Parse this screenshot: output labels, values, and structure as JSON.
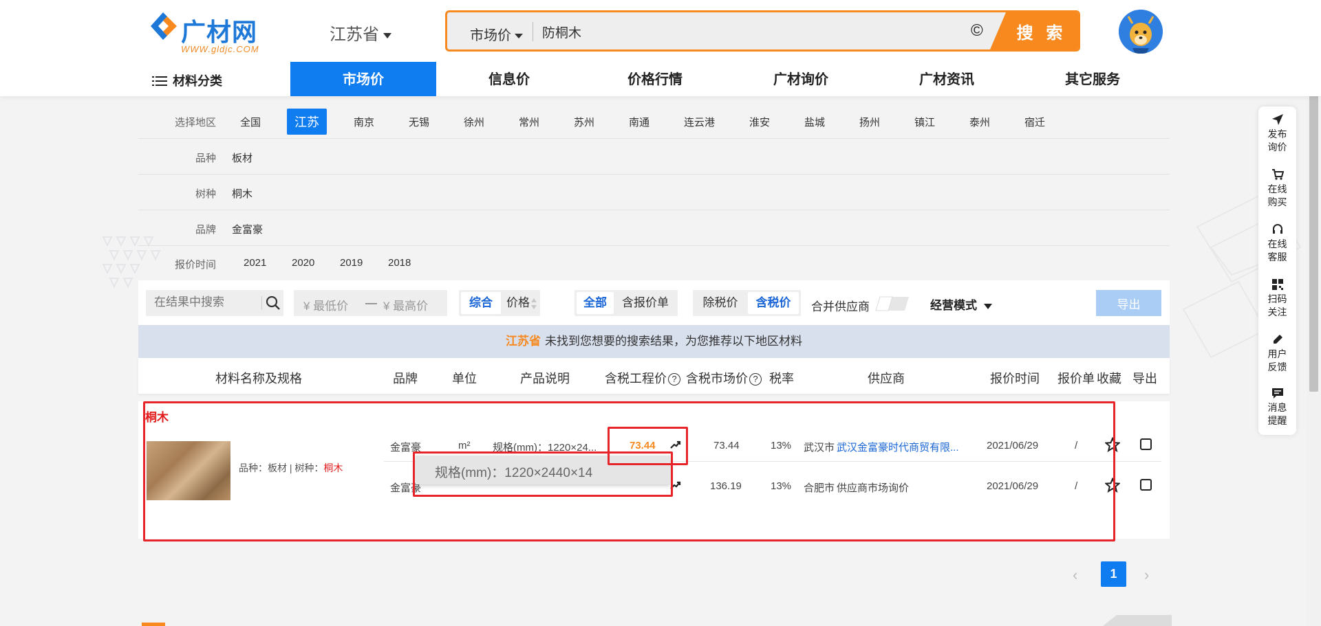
{
  "header": {
    "logo": {
      "text": "广材网",
      "sub": "WWW.gldjc.COM"
    },
    "region": "江苏省",
    "search": {
      "type": "市场价",
      "query": "防桐木",
      "clear_symbol": "©",
      "button": "搜 索"
    }
  },
  "nav": {
    "category": "材料分类",
    "items": [
      "市场价",
      "信息价",
      "价格行情",
      "广材询价",
      "广材资讯",
      "其它服务"
    ],
    "active_index": 0
  },
  "filters": {
    "region": {
      "label": "选择地区",
      "options": [
        "全国",
        "江苏",
        "南京",
        "无锡",
        "徐州",
        "常州",
        "苏州",
        "南通",
        "连云港",
        "淮安",
        "盐城",
        "扬州",
        "镇江",
        "泰州",
        "宿迁"
      ],
      "selected": "江苏"
    },
    "variety": {
      "label": "品种",
      "value": "板材"
    },
    "species": {
      "label": "树种",
      "value": "桐木"
    },
    "brand": {
      "label": "品牌",
      "value": "金富豪"
    },
    "quote_time": {
      "label": "报价时间",
      "options": [
        "2021",
        "2020",
        "2019",
        "2018"
      ]
    }
  },
  "toolbar": {
    "search_placeholder": "在结果中搜索",
    "price_min": "¥  最低价",
    "price_sep": "—",
    "price_max": "¥  最高价",
    "sort": [
      "综合",
      "价格"
    ],
    "sort_active": "综合",
    "scope": [
      "全部",
      "含报价单"
    ],
    "scope_active": "全部",
    "tax": [
      "除税价",
      "含税价"
    ],
    "tax_active": "含税价",
    "merge_label": "合并供应商",
    "mode_label": "经营模式",
    "export_label": "导出"
  },
  "notice": {
    "region": "江苏省",
    "text": "未找到您想要的搜索结果，为您推荐以下地区材料"
  },
  "table": {
    "headers": [
      "材料名称及规格",
      "品牌",
      "单位",
      "产品说明",
      "含税工程价",
      "含税市场价",
      "税率",
      "供应商",
      "报价时间",
      "报价单",
      "收藏",
      "导出"
    ],
    "help_symbol": "?"
  },
  "result": {
    "title": "桐木",
    "meta_prefix": "品种：板材 | 树种：",
    "meta_species": "桐木",
    "rows": [
      {
        "brand": "金富豪",
        "unit": "m²",
        "desc": "规格(mm)：1220×24...",
        "eng_price": "73.44",
        "market_price": "73.44",
        "tax": "13%",
        "city": "武汉市",
        "supplier": "武汉金富豪时代商贸有限...",
        "date": "2021/06/29",
        "quote": "/"
      },
      {
        "brand": "金富豪",
        "unit": "",
        "desc": "",
        "eng_price": "",
        "market_price": "136.19",
        "tax": "13%",
        "city": "合肥市",
        "supplier": "供应商市场询价",
        "date": "2021/06/29",
        "quote": "/"
      }
    ],
    "tooltip": "规格(mm)：1220×2440×14"
  },
  "pagination": {
    "prev": "‹",
    "current": "1",
    "next": "›"
  },
  "side_bar": [
    {
      "icon": "send-icon",
      "line1": "发布",
      "line2": "询价"
    },
    {
      "icon": "cart-icon",
      "line1": "在线",
      "line2": "购买"
    },
    {
      "icon": "headset-icon",
      "line1": "在线",
      "line2": "客服"
    },
    {
      "icon": "qrcode-icon",
      "line1": "扫码",
      "line2": "关注"
    },
    {
      "icon": "edit-icon",
      "line1": "用户",
      "line2": "反馈"
    },
    {
      "icon": "message-icon",
      "line1": "消息",
      "line2": "提醒"
    }
  ],
  "colors": {
    "primary": "#0f7df0",
    "accent": "#f7891f",
    "highlight_red": "#e21c1c",
    "annotation_red": "#e8242b"
  }
}
